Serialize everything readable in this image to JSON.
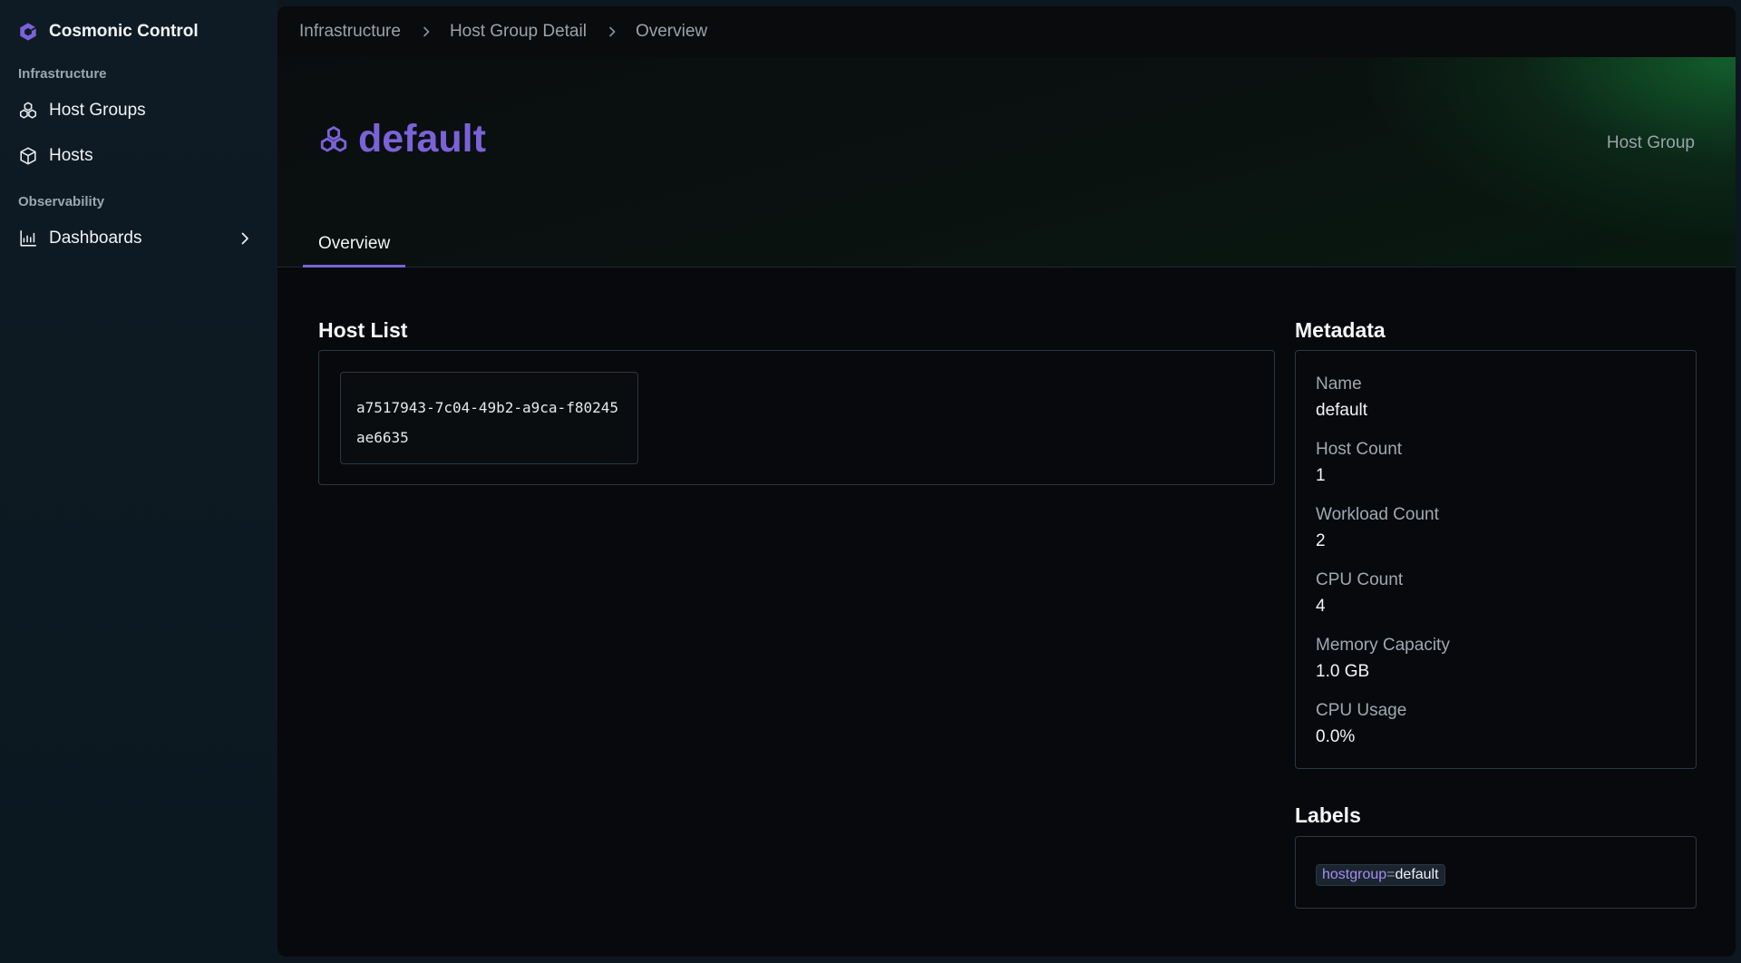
{
  "app": {
    "name": "Cosmonic Control"
  },
  "sidebar": {
    "sections": [
      {
        "label": "Infrastructure"
      },
      {
        "label": "Observability"
      }
    ],
    "items": [
      {
        "label": "Host Groups",
        "icon": "host-groups-icon"
      },
      {
        "label": "Hosts",
        "icon": "cube-icon"
      },
      {
        "label": "Dashboards",
        "icon": "chart-icon"
      }
    ]
  },
  "breadcrumb": [
    "Infrastructure",
    "Host Group Detail",
    "Overview"
  ],
  "header": {
    "title": "default",
    "type_label": "Host Group"
  },
  "tabs": [
    {
      "label": "Overview"
    }
  ],
  "host_list": {
    "title": "Host List",
    "hosts": [
      "a7517943-7c04-49b2-a9ca-f80245ae6635"
    ]
  },
  "metadata": {
    "title": "Metadata",
    "rows": [
      {
        "key": "Name",
        "value": "default"
      },
      {
        "key": "Host Count",
        "value": "1"
      },
      {
        "key": "Workload Count",
        "value": "2"
      },
      {
        "key": "CPU Count",
        "value": "4"
      },
      {
        "key": "Memory Capacity",
        "value": "1.0 GB"
      },
      {
        "key": "CPU Usage",
        "value": "0.0%"
      }
    ]
  },
  "labels": {
    "title": "Labels",
    "items": [
      {
        "key": "hostgroup",
        "sep": "=",
        "value": "default"
      }
    ]
  },
  "colors": {
    "accent": "#7b62d8",
    "label_key": "#a98cf0",
    "glow": "#167837"
  }
}
